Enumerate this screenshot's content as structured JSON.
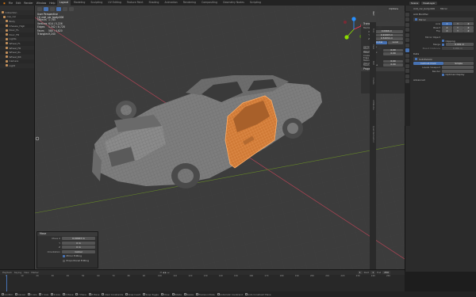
{
  "topbar": {
    "menus": [
      "File",
      "Edit",
      "Render",
      "Window",
      "Help"
    ],
    "tabs": [
      "Layout",
      "Modeling",
      "Sculpting",
      "UV Editing",
      "Texture Paint",
      "Shading",
      "Animation",
      "Rendering",
      "Compositing",
      "Geometry Nodes",
      "Scripting"
    ],
    "active_tab": "Layout",
    "scene_label": "Scene",
    "layer_label": "ViewLayer"
  },
  "outliner": {
    "items": [
      "Collection",
      "cop_car",
      "Body",
      "Chassis_High",
      "Door_FL",
      "Door_FR",
      "Lights",
      "Wheel_FL",
      "Wheel_FR",
      "Wheel_RL",
      "Wheel_RR",
      "Camera",
      "Light"
    ]
  },
  "viewport": {
    "view_name": "User Perspective",
    "object_name": "(1) mdl_car_body.006",
    "stats": [
      {
        "label": "Objects",
        "value": "1 / 65"
      },
      {
        "label": "Vertices",
        "value": "614 / 5,226"
      },
      {
        "label": "Edges",
        "value": "1,342 / 8,728"
      },
      {
        "label": "Faces",
        "value": "580 / 4,820"
      },
      {
        "label": "Triangles",
        "value": "9,240"
      }
    ],
    "options_label": "Options"
  },
  "npanel": {
    "transform_title": "Transform",
    "median_label": "Median:",
    "fields": [
      {
        "key": "X",
        "value": "0.0966 m"
      },
      {
        "key": "Y",
        "value": "0.91993 m"
      },
      {
        "key": "Z",
        "value": "0.54934 m"
      }
    ],
    "space_local": "Local",
    "space_global": "Global",
    "vertex_weights_title": "Vertex Data:",
    "vertex_rows": [
      {
        "key": "Mean Bevel Weight",
        "value": "0.00"
      },
      {
        "key": "Mean Vertex Crease",
        "value": "0.00"
      }
    ],
    "edge_title": "Edge Data:",
    "edge_rows": [
      {
        "key": "Mean Bevel Weight",
        "value": "0.00"
      },
      {
        "key": "Mean Crease",
        "value": "0.00"
      }
    ],
    "properties_title": "Properties",
    "vertical_tabs": [
      "Item",
      "Tool",
      "View",
      "Edit",
      "Create",
      "Attributes",
      "Quad Remesher"
    ]
  },
  "operator_panel": {
    "title": "Move",
    "rows": [
      {
        "key": "Move X",
        "value": "0.00633 m"
      },
      {
        "key": "Y",
        "value": "0 m"
      },
      {
        "key": "Z",
        "value": "0 m"
      }
    ],
    "orientation_label": "Orientation",
    "orientation_value": "Global",
    "mirror_editing": "Mirror Editing",
    "proportional_editing": "Proportional Editing"
  },
  "properties_editor": {
    "object_name": "mdl_car_body.006",
    "modifier_label": "Mirror",
    "add_modifier": "Add Modifier",
    "modifier_name": "Mirror",
    "axis_label": "Axis",
    "bisect_label": "Bisect",
    "flip_label": "Flip",
    "axis_values": [
      "X",
      "Y",
      "Z"
    ],
    "mirror_object_label": "Mirror Object",
    "clipping_label": "Clipping",
    "merge_label": "Merge",
    "merge_value": "0.001 m",
    "bisect_distance_label": "Bisect Distance",
    "data_label": "Data",
    "subdivision_label": "Subdivision",
    "catmull_label": "Catmull-Clark",
    "simple_label": "Simple",
    "levels_viewport_label": "Levels Viewport",
    "render_label": "Render",
    "optimal_display_label": "Optimal Display",
    "advanced_label": "Advanced"
  },
  "timeline": {
    "label": "Playback",
    "menus": [
      "Keying",
      "View",
      "Marker"
    ],
    "start_label": "Start",
    "start_value": "1",
    "end_label": "End",
    "end_value": "250",
    "current_frame": "1",
    "ruler": [
      "0",
      "10",
      "20",
      "30",
      "40",
      "50",
      "60",
      "70",
      "80",
      "90",
      "100",
      "110",
      "120",
      "130",
      "140",
      "150",
      "160",
      "170",
      "180",
      "190",
      "200",
      "210",
      "220",
      "230",
      "240",
      "250"
    ]
  },
  "statusbar": {
    "items": [
      "Confirm",
      "Cancel",
      "X Axis",
      "Y Axis",
      "Z Axis",
      "X Plane",
      "Y Plane",
      "Z Plane",
      "Clear Constraints",
      "Snap Invert",
      "Snap Toggle",
      "Move",
      "Rotate",
      "Resize",
      "Precision Mode",
      "Automatic Constraint",
      "Auto Constraint Plane"
    ]
  },
  "colors": {
    "accent": "#4772b3",
    "selection": "#f29a4d",
    "x_axis": "#ff3352",
    "y_axis": "#8bdc00",
    "z_axis": "#2890ff"
  }
}
